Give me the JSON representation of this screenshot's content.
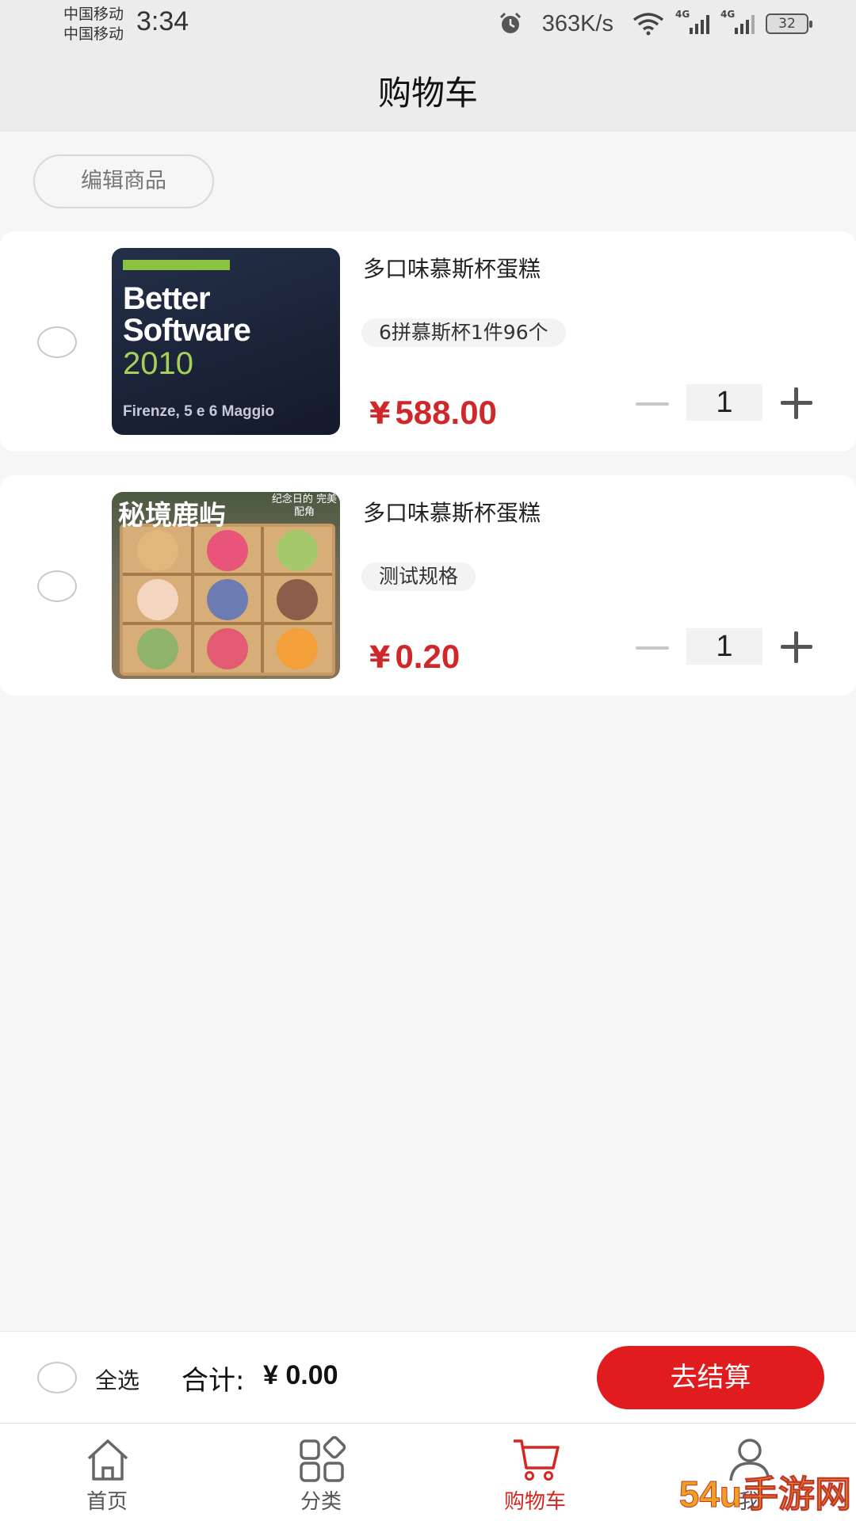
{
  "status_bar": {
    "carrier1": "中国移动",
    "carrier2": "中国移动",
    "time": "3:34",
    "net_speed": "363K/s",
    "signal_tag": "4G",
    "battery": "32"
  },
  "header": {
    "title": "购物车"
  },
  "toolbar": {
    "edit_label": "编辑商品"
  },
  "cart": {
    "items": [
      {
        "name": "多口味慕斯杯蛋糕",
        "spec": "6拼慕斯杯1件96个",
        "currency": "¥",
        "price": "588.00",
        "quantity": "1",
        "image": {
          "bar_color": "#8ac43f",
          "line1": "Better",
          "line2": "Software",
          "line3": "2010",
          "line4": "Firenze, 5 e 6 Maggio"
        }
      },
      {
        "name": "多口味慕斯杯蛋糕",
        "spec": "测试规格",
        "currency": "¥",
        "price": "0.20",
        "quantity": "1",
        "image": {
          "title": "秘境鹿屿",
          "subtitle": "纪念日的 完美配角"
        }
      }
    ]
  },
  "footer": {
    "select_all_label": "全选",
    "total_label": "合计:",
    "total_value": "¥ 0.00",
    "checkout_label": "去结算"
  },
  "tabbar": {
    "tabs": [
      {
        "label": "首页",
        "icon": "home-icon"
      },
      {
        "label": "分类",
        "icon": "category-icon"
      },
      {
        "label": "购物车",
        "icon": "cart-icon",
        "active": true
      },
      {
        "label": "我",
        "icon": "user-icon"
      }
    ]
  },
  "watermark": {
    "text": "54u手游网"
  },
  "colors": {
    "accent": "#d0282a",
    "checkout": "#e01c1f",
    "background": "#f6f6f6",
    "header": "#ececec"
  }
}
